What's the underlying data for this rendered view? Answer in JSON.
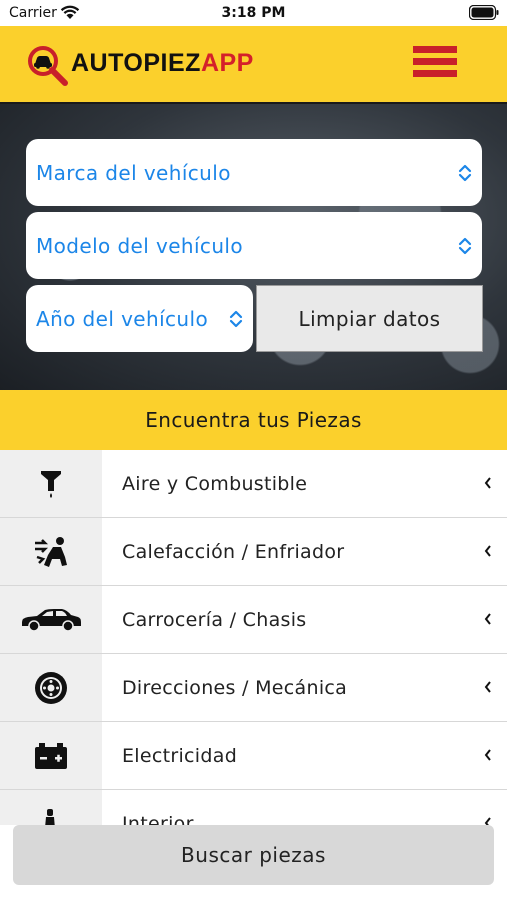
{
  "status_bar": {
    "carrier": "Carrier",
    "time": "3:18 PM"
  },
  "header": {
    "logo_text_main": "AUTOPIEZ",
    "logo_text_accent": "APP",
    "colors": {
      "yellow": "#fbd02c",
      "red": "#c8202a"
    }
  },
  "vehicle_form": {
    "brand_select": "Marca del vehículo",
    "model_select": "Modelo del vehículo",
    "year_select": "Año del vehículo",
    "clear_button": "Limpiar datos"
  },
  "find_banner": "Encuentra tus Piezas",
  "categories": [
    {
      "label": "Aire y Combustible",
      "icon": "fuel-filter-icon"
    },
    {
      "label": "Calefacción / Enfriador",
      "icon": "climate-icon"
    },
    {
      "label": "Carrocería / Chasis",
      "icon": "car-icon"
    },
    {
      "label": "Direcciones / Mecánica",
      "icon": "brake-disc-icon"
    },
    {
      "label": "Electricidad",
      "icon": "battery-icon"
    },
    {
      "label": "Interior",
      "icon": "seat-icon"
    }
  ],
  "search_button": "Buscar piezas"
}
